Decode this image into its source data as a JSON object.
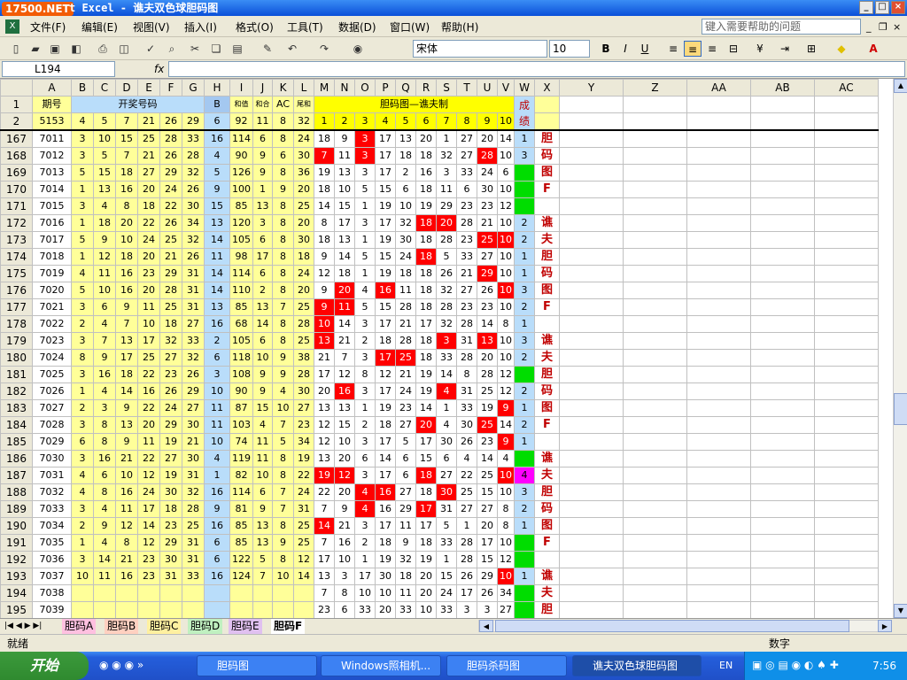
{
  "title": {
    "logo": "17500.NET",
    "text": "t Excel - 谯夫双色球胆码图"
  },
  "menu": [
    "文件(F)",
    "编辑(E)",
    "视图(V)",
    "插入(I)",
    "格式(O)",
    "工具(T)",
    "数据(D)",
    "窗口(W)",
    "帮助(H)"
  ],
  "help_placeholder": "键入需要帮助的问题",
  "font": {
    "name": "宋体",
    "size": "10"
  },
  "namebox": "L194",
  "fx": "fx",
  "cols": [
    "A",
    "B",
    "C",
    "D",
    "E",
    "F",
    "G",
    "H",
    "I",
    "J",
    "K",
    "L",
    "M",
    "N",
    "O",
    "P",
    "Q",
    "R",
    "S",
    "T",
    "U",
    "V",
    "W",
    "X",
    "Y",
    "Z",
    "AA",
    "AB",
    "AC"
  ],
  "hdr": {
    "qihao": "期号",
    "kaijiang": "开奖号码",
    "b": "B",
    "hezhi": "和值",
    "hewei": "和合",
    "ac": "AC",
    "weihe": "尾和",
    "danma": "胆码图—谯夫制",
    "cj1": "成",
    "cj2": "绩"
  },
  "row2": {
    "rn": "2",
    "qi": "5153",
    "nums": [
      "4",
      "5",
      "7",
      "21",
      "26",
      "29"
    ],
    "b": "6",
    "hz": "92",
    "hw": "11",
    "ac": "8",
    "wh": "32",
    "dm": [
      "1",
      "2",
      "3",
      "4",
      "5",
      "6",
      "7",
      "8",
      "9",
      "10"
    ]
  },
  "rows": [
    {
      "rn": "167",
      "qi": "7011",
      "n": [
        "3",
        "10",
        "15",
        "25",
        "28",
        "33"
      ],
      "b": "16",
      "s": [
        "114",
        "6",
        "8",
        "24"
      ],
      "m": [
        "18",
        "9",
        "3",
        "17",
        "13",
        "20",
        "1",
        "27",
        "20",
        "14"
      ],
      "red": [
        2
      ],
      "w": "1",
      "wc": "lb",
      "x": "胆"
    },
    {
      "rn": "168",
      "qi": "7012",
      "n": [
        "3",
        "5",
        "7",
        "21",
        "26",
        "28"
      ],
      "b": "4",
      "s": [
        "90",
        "9",
        "6",
        "30"
      ],
      "m": [
        "7",
        "11",
        "3",
        "17",
        "18",
        "18",
        "32",
        "27",
        "28",
        "10"
      ],
      "red": [
        0,
        2,
        8
      ],
      "w": "3",
      "wc": "lb",
      "x": "码"
    },
    {
      "rn": "169",
      "qi": "7013",
      "n": [
        "5",
        "15",
        "18",
        "27",
        "29",
        "32"
      ],
      "b": "5",
      "s": [
        "126",
        "9",
        "8",
        "36"
      ],
      "m": [
        "19",
        "13",
        "3",
        "17",
        "2",
        "16",
        "3",
        "33",
        "24",
        "6"
      ],
      "red": [],
      "w": "",
      "wc": "gr",
      "x": "图"
    },
    {
      "rn": "170",
      "qi": "7014",
      "n": [
        "1",
        "13",
        "16",
        "20",
        "24",
        "26"
      ],
      "b": "9",
      "s": [
        "100",
        "1",
        "9",
        "20"
      ],
      "m": [
        "18",
        "10",
        "5",
        "15",
        "6",
        "18",
        "11",
        "6",
        "30",
        "10"
      ],
      "red": [],
      "w": "",
      "wc": "gr",
      "x": "F"
    },
    {
      "rn": "171",
      "qi": "7015",
      "n": [
        "3",
        "4",
        "8",
        "18",
        "22",
        "30"
      ],
      "b": "15",
      "s": [
        "85",
        "13",
        "8",
        "25"
      ],
      "m": [
        "14",
        "15",
        "1",
        "19",
        "10",
        "19",
        "29",
        "23",
        "23",
        "12"
      ],
      "red": [],
      "w": "",
      "wc": "gr",
      "x": ""
    },
    {
      "rn": "172",
      "qi": "7016",
      "n": [
        "1",
        "18",
        "20",
        "22",
        "26",
        "34"
      ],
      "b": "13",
      "s": [
        "120",
        "3",
        "8",
        "20"
      ],
      "m": [
        "8",
        "17",
        "3",
        "17",
        "32",
        "18",
        "20",
        "28",
        "21",
        "10"
      ],
      "red": [
        5,
        6
      ],
      "w": "2",
      "wc": "lb",
      "x": "谯"
    },
    {
      "rn": "173",
      "qi": "7017",
      "n": [
        "5",
        "9",
        "10",
        "24",
        "25",
        "32"
      ],
      "b": "14",
      "s": [
        "105",
        "6",
        "8",
        "30"
      ],
      "m": [
        "18",
        "13",
        "1",
        "19",
        "30",
        "18",
        "28",
        "23",
        "25",
        "10"
      ],
      "red": [
        8,
        9
      ],
      "w": "2",
      "wc": "lb",
      "x": "夫"
    },
    {
      "rn": "174",
      "qi": "7018",
      "n": [
        "1",
        "12",
        "18",
        "20",
        "21",
        "26"
      ],
      "b": "11",
      "s": [
        "98",
        "17",
        "8",
        "18"
      ],
      "m": [
        "9",
        "14",
        "5",
        "15",
        "24",
        "18",
        "5",
        "33",
        "27",
        "10"
      ],
      "red": [
        5
      ],
      "w": "1",
      "wc": "lb",
      "x": "胆"
    },
    {
      "rn": "175",
      "qi": "7019",
      "n": [
        "4",
        "11",
        "16",
        "23",
        "29",
        "31"
      ],
      "b": "14",
      "s": [
        "114",
        "6",
        "8",
        "24"
      ],
      "m": [
        "12",
        "18",
        "1",
        "19",
        "18",
        "18",
        "26",
        "21",
        "29",
        "10"
      ],
      "red": [
        8
      ],
      "w": "1",
      "wc": "lb",
      "x": "码"
    },
    {
      "rn": "176",
      "qi": "7020",
      "n": [
        "5",
        "10",
        "16",
        "20",
        "28",
        "31"
      ],
      "b": "14",
      "s": [
        "110",
        "2",
        "8",
        "20"
      ],
      "m": [
        "9",
        "20",
        "4",
        "16",
        "11",
        "18",
        "32",
        "27",
        "26",
        "10"
      ],
      "red": [
        1,
        3,
        9
      ],
      "w": "3",
      "wc": "lb",
      "x": "图"
    },
    {
      "rn": "177",
      "qi": "7021",
      "n": [
        "3",
        "6",
        "9",
        "11",
        "25",
        "31"
      ],
      "b": "13",
      "s": [
        "85",
        "13",
        "7",
        "25"
      ],
      "m": [
        "9",
        "11",
        "5",
        "15",
        "28",
        "18",
        "28",
        "23",
        "23",
        "10"
      ],
      "red": [
        0,
        1
      ],
      "w": "2",
      "wc": "lb",
      "x": "F"
    },
    {
      "rn": "178",
      "qi": "7022",
      "n": [
        "2",
        "4",
        "7",
        "10",
        "18",
        "27"
      ],
      "b": "16",
      "s": [
        "68",
        "14",
        "8",
        "28"
      ],
      "m": [
        "10",
        "14",
        "3",
        "17",
        "21",
        "17",
        "32",
        "28",
        "14",
        "8"
      ],
      "red": [
        0
      ],
      "w": "1",
      "wc": "lb",
      "x": ""
    },
    {
      "rn": "179",
      "qi": "7023",
      "n": [
        "3",
        "7",
        "13",
        "17",
        "32",
        "33"
      ],
      "b": "2",
      "s": [
        "105",
        "6",
        "8",
        "25"
      ],
      "m": [
        "13",
        "21",
        "2",
        "18",
        "28",
        "18",
        "3",
        "31",
        "13",
        "10"
      ],
      "red": [
        0,
        6,
        8
      ],
      "w": "3",
      "wc": "lb",
      "x": "谯"
    },
    {
      "rn": "180",
      "qi": "7024",
      "n": [
        "8",
        "9",
        "17",
        "25",
        "27",
        "32"
      ],
      "b": "6",
      "s": [
        "118",
        "10",
        "9",
        "38"
      ],
      "m": [
        "21",
        "7",
        "3",
        "17",
        "25",
        "18",
        "33",
        "28",
        "20",
        "10"
      ],
      "red": [
        3,
        4
      ],
      "w": "2",
      "wc": "lb",
      "x": "夫"
    },
    {
      "rn": "181",
      "qi": "7025",
      "n": [
        "3",
        "16",
        "18",
        "22",
        "23",
        "26"
      ],
      "b": "3",
      "s": [
        "108",
        "9",
        "9",
        "28"
      ],
      "m": [
        "17",
        "12",
        "8",
        "12",
        "21",
        "19",
        "14",
        "8",
        "28",
        "12"
      ],
      "red": [],
      "w": "",
      "wc": "gr",
      "x": "胆"
    },
    {
      "rn": "182",
      "qi": "7026",
      "n": [
        "1",
        "4",
        "14",
        "16",
        "26",
        "29"
      ],
      "b": "10",
      "s": [
        "90",
        "9",
        "4",
        "30"
      ],
      "m": [
        "20",
        "16",
        "3",
        "17",
        "24",
        "19",
        "4",
        "31",
        "25",
        "12"
      ],
      "red": [
        1,
        6
      ],
      "w": "2",
      "wc": "lb",
      "x": "码"
    },
    {
      "rn": "183",
      "qi": "7027",
      "n": [
        "2",
        "3",
        "9",
        "22",
        "24",
        "27"
      ],
      "b": "11",
      "s": [
        "87",
        "15",
        "10",
        "27"
      ],
      "m": [
        "13",
        "13",
        "1",
        "19",
        "23",
        "14",
        "1",
        "33",
        "19",
        "9"
      ],
      "red": [
        9
      ],
      "w": "1",
      "wc": "lb",
      "x": "图"
    },
    {
      "rn": "184",
      "qi": "7028",
      "n": [
        "3",
        "8",
        "13",
        "20",
        "29",
        "30"
      ],
      "b": "11",
      "s": [
        "103",
        "4",
        "7",
        "23"
      ],
      "m": [
        "12",
        "15",
        "2",
        "18",
        "27",
        "20",
        "4",
        "30",
        "25",
        "14"
      ],
      "red": [
        5,
        8
      ],
      "w": "2",
      "wc": "lb",
      "x": "F"
    },
    {
      "rn": "185",
      "qi": "7029",
      "n": [
        "6",
        "8",
        "9",
        "11",
        "19",
        "21"
      ],
      "b": "10",
      "s": [
        "74",
        "11",
        "5",
        "34"
      ],
      "m": [
        "12",
        "10",
        "3",
        "17",
        "5",
        "17",
        "30",
        "26",
        "23",
        "9"
      ],
      "red": [
        9
      ],
      "w": "1",
      "wc": "lb",
      "x": ""
    },
    {
      "rn": "186",
      "qi": "7030",
      "n": [
        "3",
        "16",
        "21",
        "22",
        "27",
        "30"
      ],
      "b": "4",
      "s": [
        "119",
        "11",
        "8",
        "19"
      ],
      "m": [
        "13",
        "20",
        "6",
        "14",
        "6",
        "15",
        "6",
        "4",
        "14",
        "4"
      ],
      "red": [],
      "w": "",
      "wc": "gr",
      "x": "谯"
    },
    {
      "rn": "187",
      "qi": "7031",
      "n": [
        "4",
        "6",
        "10",
        "12",
        "19",
        "31"
      ],
      "b": "1",
      "s": [
        "82",
        "10",
        "8",
        "22"
      ],
      "m": [
        "19",
        "12",
        "3",
        "17",
        "6",
        "18",
        "27",
        "22",
        "25",
        "10"
      ],
      "red": [
        0,
        1,
        5,
        9
      ],
      "w": "4",
      "wc": "mg",
      "x": "夫"
    },
    {
      "rn": "188",
      "qi": "7032",
      "n": [
        "4",
        "8",
        "16",
        "24",
        "30",
        "32"
      ],
      "b": "16",
      "s": [
        "114",
        "6",
        "7",
        "24"
      ],
      "m": [
        "22",
        "20",
        "4",
        "16",
        "27",
        "18",
        "30",
        "25",
        "15",
        "10"
      ],
      "red": [
        2,
        3,
        6
      ],
      "w": "3",
      "wc": "lb",
      "x": "胆"
    },
    {
      "rn": "189",
      "qi": "7033",
      "n": [
        "3",
        "4",
        "11",
        "17",
        "18",
        "28"
      ],
      "b": "9",
      "s": [
        "81",
        "9",
        "7",
        "31"
      ],
      "m": [
        "7",
        "9",
        "4",
        "16",
        "29",
        "17",
        "31",
        "27",
        "27",
        "8"
      ],
      "red": [
        2,
        5
      ],
      "w": "2",
      "wc": "lb",
      "x": "码"
    },
    {
      "rn": "190",
      "qi": "7034",
      "n": [
        "2",
        "9",
        "12",
        "14",
        "23",
        "25"
      ],
      "b": "16",
      "s": [
        "85",
        "13",
        "8",
        "25"
      ],
      "m": [
        "14",
        "21",
        "3",
        "17",
        "11",
        "17",
        "5",
        "1",
        "20",
        "8"
      ],
      "red": [
        0
      ],
      "w": "1",
      "wc": "lb",
      "x": "图"
    },
    {
      "rn": "191",
      "qi": "7035",
      "n": [
        "1",
        "4",
        "8",
        "12",
        "29",
        "31"
      ],
      "b": "6",
      "s": [
        "85",
        "13",
        "9",
        "25"
      ],
      "m": [
        "7",
        "16",
        "2",
        "18",
        "9",
        "18",
        "33",
        "28",
        "17",
        "10"
      ],
      "red": [],
      "w": "",
      "wc": "gr",
      "x": "F"
    },
    {
      "rn": "192",
      "qi": "7036",
      "n": [
        "3",
        "14",
        "21",
        "23",
        "30",
        "31"
      ],
      "b": "6",
      "s": [
        "122",
        "5",
        "8",
        "12"
      ],
      "m": [
        "17",
        "10",
        "1",
        "19",
        "32",
        "19",
        "1",
        "28",
        "15",
        "12"
      ],
      "red": [],
      "w": "",
      "wc": "gr",
      "x": ""
    },
    {
      "rn": "193",
      "qi": "7037",
      "n": [
        "10",
        "11",
        "16",
        "23",
        "31",
        "33"
      ],
      "b": "16",
      "s": [
        "124",
        "7",
        "10",
        "14"
      ],
      "m": [
        "13",
        "3",
        "17",
        "30",
        "18",
        "20",
        "15",
        "26",
        "29",
        "10"
      ],
      "red": [
        9
      ],
      "w": "1",
      "wc": "lb",
      "x": "谯"
    },
    {
      "rn": "194",
      "qi": "7038",
      "n": [
        "",
        "",
        "",
        "",
        "",
        ""
      ],
      "b": "",
      "s": [
        "",
        "",
        "",
        ""
      ],
      "m": [
        "7",
        "8",
        "10",
        "10",
        "11",
        "20",
        "24",
        "17",
        "26",
        "34"
      ],
      "red": [],
      "w": "",
      "wc": "gr",
      "x": "夫"
    },
    {
      "rn": "195",
      "qi": "7039",
      "n": [
        "",
        "",
        "",
        "",
        "",
        ""
      ],
      "b": "",
      "s": [
        "",
        "",
        "",
        ""
      ],
      "m": [
        "23",
        "6",
        "33",
        "20",
        "33",
        "10",
        "33",
        "3",
        "3",
        "27"
      ],
      "red": [],
      "w": "",
      "wc": "gr",
      "x": "胆"
    }
  ],
  "tabs": [
    "胆码A",
    "胆码B",
    "胆码C",
    "胆码D",
    "胆码E",
    "胆码F"
  ],
  "status": {
    "ready": "就绪",
    "mode": "数字"
  },
  "taskbar": {
    "start": "开始",
    "items": [
      "胆码图",
      "Windows照相机...",
      "胆码杀码图",
      "谯夫双色球胆码图"
    ],
    "lang": "EN",
    "time": "7:56"
  }
}
